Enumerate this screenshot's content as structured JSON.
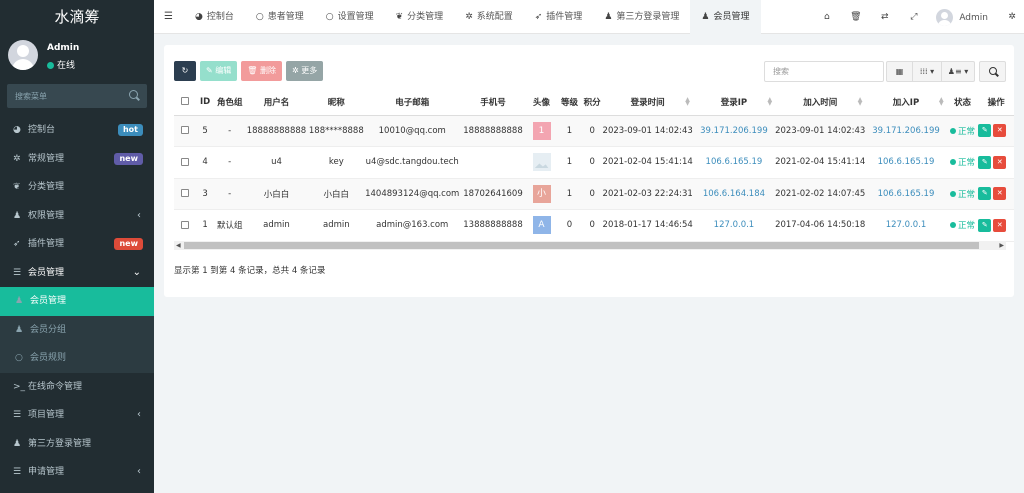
{
  "sidebar": {
    "logo": "水滴筹",
    "user": {
      "name": "Admin",
      "status": "在线"
    },
    "search_placeholder": "搜索菜单",
    "items": [
      {
        "icon": "dashboard-icon",
        "glyph": "◕",
        "label": "控制台",
        "badge": "hot",
        "badge_color": "#3c8dbc",
        "caret": "",
        "state": ""
      },
      {
        "icon": "cogs-icon",
        "glyph": "✲",
        "label": "常规管理",
        "badge": "new",
        "badge_color": "#605ca8",
        "caret": "",
        "state": ""
      },
      {
        "icon": "leaf-icon",
        "glyph": "❦",
        "label": "分类管理",
        "badge": "",
        "badge_color": "",
        "caret": "",
        "state": ""
      },
      {
        "icon": "group-icon",
        "glyph": "♟",
        "label": "权限管理",
        "badge": "",
        "badge_color": "",
        "caret": "‹",
        "state": ""
      },
      {
        "icon": "rocket-icon",
        "glyph": "➶",
        "label": "插件管理",
        "badge": "new",
        "badge_color": "#dd4b39",
        "caret": "",
        "state": ""
      },
      {
        "icon": "list-icon",
        "glyph": "☰",
        "label": "会员管理",
        "badge": "",
        "badge_color": "",
        "caret": "⌄",
        "state": "open"
      },
      {
        "icon": "user-icon",
        "glyph": "♟",
        "label": "会员管理",
        "badge": "",
        "badge_color": "",
        "caret": "",
        "state": "sub active"
      },
      {
        "icon": "users-icon",
        "glyph": "♟",
        "label": "会员分组",
        "badge": "",
        "badge_color": "",
        "caret": "",
        "state": "sub"
      },
      {
        "icon": "circle-icon",
        "glyph": "○",
        "label": "会员规则",
        "badge": "",
        "badge_color": "",
        "caret": "",
        "state": "sub"
      },
      {
        "icon": "terminal-icon",
        "glyph": ">_",
        "label": "在线命令管理",
        "badge": "",
        "badge_color": "",
        "caret": "",
        "state": ""
      },
      {
        "icon": "list-icon",
        "glyph": "☰",
        "label": "项目管理",
        "badge": "",
        "badge_color": "",
        "caret": "‹",
        "state": ""
      },
      {
        "icon": "users-icon",
        "glyph": "♟",
        "label": "第三方登录管理",
        "badge": "",
        "badge_color": "",
        "caret": "",
        "state": ""
      },
      {
        "icon": "list-icon",
        "glyph": "☰",
        "label": "申请管理",
        "badge": "",
        "badge_color": "",
        "caret": "‹",
        "state": ""
      }
    ]
  },
  "topbar": {
    "tabs": [
      {
        "icon": "dashboard-icon",
        "glyph": "◕",
        "label": "控制台",
        "active": false
      },
      {
        "icon": "circle-icon",
        "glyph": "○",
        "label": "患者管理",
        "active": false
      },
      {
        "icon": "circle-icon",
        "glyph": "○",
        "label": "设置管理",
        "active": false
      },
      {
        "icon": "leaf-icon",
        "glyph": "❦",
        "label": "分类管理",
        "active": false
      },
      {
        "icon": "cog-icon",
        "glyph": "✲",
        "label": "系统配置",
        "active": false
      },
      {
        "icon": "rocket-icon",
        "glyph": "➶",
        "label": "插件管理",
        "active": false
      },
      {
        "icon": "users-icon",
        "glyph": "♟",
        "label": "第三方登录管理",
        "active": false
      },
      {
        "icon": "user-icon",
        "glyph": "♟",
        "label": "会员管理",
        "active": true
      }
    ],
    "right_icons": [
      {
        "icon": "home-icon",
        "glyph": "⌂"
      },
      {
        "icon": "trash-icon",
        "glyph": "🗑"
      },
      {
        "icon": "translate-icon",
        "glyph": "⇄"
      },
      {
        "icon": "fullscreen-icon",
        "glyph": "⤢"
      }
    ],
    "user": "Admin",
    "settings_glyph": "✲"
  },
  "toolbar": {
    "refresh_glyph": "↻",
    "edit_label": "✎ 编辑",
    "delete_label": "🗑 删除",
    "more_label": "✲ 更多",
    "search_placeholder": "搜索"
  },
  "table": {
    "columns": [
      "ID",
      "角色组",
      "用户名",
      "昵称",
      "电子邮箱",
      "手机号",
      "头像",
      "等级",
      "积分",
      "登录时间",
      "登录IP",
      "加入时间",
      "加入IP",
      "状态",
      "操作"
    ],
    "sortable": [
      false,
      false,
      false,
      false,
      false,
      false,
      false,
      false,
      false,
      true,
      true,
      true,
      true,
      false,
      false
    ],
    "rows": [
      {
        "id": "5",
        "group": "-",
        "username": "18888888888",
        "nickname": "188****8888",
        "email": "10010@qq.com",
        "mobile": "18888888888",
        "avatar": {
          "text": "1",
          "color": "#f3a5b1",
          "type": "letter"
        },
        "level": "1",
        "score": "0",
        "logintime": "2023-09-01 14:02:43",
        "loginip": "39.171.206.199",
        "jointime": "2023-09-01 14:02:43",
        "joinip": "39.171.206.199",
        "status": "正常"
      },
      {
        "id": "4",
        "group": "-",
        "username": "u4",
        "nickname": "key",
        "email": "u4@sdc.tangdou.tech",
        "mobile": "",
        "avatar": {
          "text": "",
          "color": "#e6eef3",
          "type": "image"
        },
        "level": "1",
        "score": "0",
        "logintime": "2021-02-04 15:41:14",
        "loginip": "106.6.165.19",
        "jointime": "2021-02-04 15:41:14",
        "joinip": "106.6.165.19",
        "status": "正常"
      },
      {
        "id": "3",
        "group": "-",
        "username": "小白白",
        "nickname": "小白白",
        "email": "1404893124@qq.com",
        "mobile": "18702641609",
        "avatar": {
          "text": "小",
          "color": "#e8a59a",
          "type": "letter"
        },
        "level": "1",
        "score": "0",
        "logintime": "2021-02-03 22:24:31",
        "loginip": "106.6.164.184",
        "jointime": "2021-02-02 14:07:45",
        "joinip": "106.6.165.19",
        "status": "正常"
      },
      {
        "id": "1",
        "group": "默认组",
        "username": "admin",
        "nickname": "admin",
        "email": "admin@163.com",
        "mobile": "13888888888",
        "avatar": {
          "text": "A",
          "color": "#8fb5e8",
          "type": "letter"
        },
        "level": "0",
        "score": "0",
        "logintime": "2018-01-17 14:46:54",
        "loginip": "127.0.0.1",
        "jointime": "2017-04-06 14:50:18",
        "joinip": "127.0.0.1",
        "status": "正常"
      }
    ]
  },
  "pager_info": "显示第 1 到第 4 条记录，总共 4 条记录",
  "colors": {
    "sidebar": "#222d32",
    "accent": "#18bc9c",
    "danger": "#e74c3c",
    "link": "#3c8dbc"
  }
}
